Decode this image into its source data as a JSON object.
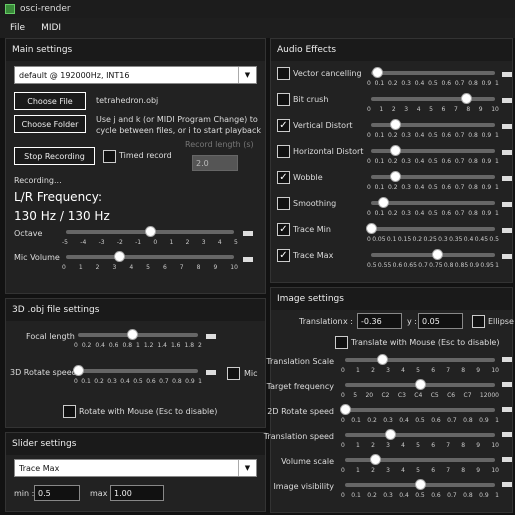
{
  "window": {
    "title": "osci-render"
  },
  "menu": [
    "File",
    "MIDI"
  ],
  "main": {
    "header": "Main settings",
    "device": "default @ 192000Hz, INT16",
    "choose_file": "Choose File",
    "file_name": "tetrahedron.obj",
    "choose_folder": "Choose Folder",
    "hint": "Use j and k (or MIDI Program Change) to cycle between files, or i to start playback",
    "stop_recording": "Stop Recording",
    "timed_record": "Timed record",
    "record_length_label": "Record length (s)",
    "record_length_value": "2.0",
    "recording": "Recording...",
    "freq_label": "L/R Frequency:",
    "freq_value": "130 Hz / 130 Hz",
    "octave_label": "Octave",
    "octave_ticks": [
      "-5",
      "-4",
      "-3",
      "-2",
      "-1",
      "0",
      "1",
      "2",
      "3",
      "4",
      "5"
    ],
    "octave_value": 0,
    "volume_label": "Mic Volume",
    "volume_ticks": [
      "0",
      "1",
      "2",
      "3",
      "4",
      "5",
      "6",
      "7",
      "8",
      "9",
      "10"
    ],
    "volume_value": 3.2
  },
  "obj": {
    "header": "3D .obj file settings",
    "focal_label": "Focal length",
    "focal_ticks": [
      "0",
      "0.2",
      "0.4",
      "0.6",
      "0.8",
      "1",
      "1.2",
      "1.4",
      "1.6",
      "1.8",
      "2"
    ],
    "focal_value": 0.9,
    "rotate_label": "3D Rotate speed",
    "rotate_ticks": [
      "0",
      "0.1",
      "0.2",
      "0.3",
      "0.4",
      "0.5",
      "0.6",
      "0.7",
      "0.8",
      "0.9",
      "1"
    ],
    "rotate_value": 0,
    "mic_label": "Mic",
    "rotate_mouse": "Rotate with Mouse (Esc to disable)"
  },
  "slider": {
    "header": "Slider settings",
    "selected": "Trace Max",
    "min_label": "min :",
    "min_value": "0.5",
    "max_label": "max :",
    "max_value": "1.00"
  },
  "effects": {
    "header": "Audio Effects",
    "items": [
      {
        "label": "Vector cancelling",
        "checked": false,
        "ticks": [
          "0",
          "0.1",
          "0.2",
          "0.3",
          "0.4",
          "0.5",
          "0.6",
          "0.7",
          "0.8",
          "0.9",
          "1"
        ],
        "value": 0.05
      },
      {
        "label": "Bit crush",
        "checked": false,
        "ticks": [
          "0",
          "1",
          "2",
          "3",
          "4",
          "5",
          "6",
          "7",
          "8",
          "9",
          "10"
        ],
        "value": 7.7
      },
      {
        "label": "Vertical Distort",
        "checked": true,
        "ticks": [
          "0",
          "0.1",
          "0.2",
          "0.3",
          "0.4",
          "0.5",
          "0.6",
          "0.7",
          "0.8",
          "0.9",
          "1"
        ],
        "value": 0.2
      },
      {
        "label": "Horizontal Distort",
        "checked": false,
        "ticks": [
          "0",
          "0.1",
          "0.2",
          "0.3",
          "0.4",
          "0.5",
          "0.6",
          "0.7",
          "0.8",
          "0.9",
          "1"
        ],
        "value": 0.2
      },
      {
        "label": "Wobble",
        "checked": true,
        "ticks": [
          "0",
          "0.1",
          "0.2",
          "0.3",
          "0.4",
          "0.5",
          "0.6",
          "0.7",
          "0.8",
          "0.9",
          "1"
        ],
        "value": 0.2
      },
      {
        "label": "Smoothing",
        "checked": false,
        "ticks": [
          "0",
          "0.1",
          "0.2",
          "0.3",
          "0.4",
          "0.5",
          "0.6",
          "0.7",
          "0.8",
          "0.9",
          "1"
        ],
        "value": 0.1
      },
      {
        "label": "Trace Min",
        "checked": true,
        "ticks": [
          "0",
          "0.05",
          "0.1",
          "0.15",
          "0.2",
          "0.25",
          "0.3",
          "0.35",
          "0.4",
          "0.45",
          "0.5"
        ],
        "value": 0.0
      },
      {
        "label": "Trace Max",
        "checked": true,
        "ticks": [
          "0.5",
          "0.55",
          "0.6",
          "0.65",
          "0.7",
          "0.75",
          "0.8",
          "0.85",
          "0.9",
          "0.95",
          "1"
        ],
        "value": 0.77
      }
    ]
  },
  "image": {
    "header": "Image settings",
    "translation_label": "Translation",
    "x_label": "x :",
    "x_value": "-0.36",
    "y_label": "y :",
    "y_value": "0.05",
    "ellipse_label": "Ellipse",
    "translate_mouse": "Translate with Mouse (Esc to disable)",
    "rows": [
      {
        "label": "Translation Scale",
        "ticks": [
          "0",
          "1",
          "2",
          "3",
          "4",
          "5",
          "6",
          "7",
          "8",
          "9",
          "10"
        ],
        "value": 0.25
      },
      {
        "label": "Target frequency",
        "ticks": [
          "0",
          "5",
          "20",
          "C2",
          "C3",
          "C4",
          "C5",
          "C6",
          "C7",
          "12000"
        ],
        "value": 0.5
      },
      {
        "label": "2D Rotate speed",
        "ticks": [
          "0",
          "0.1",
          "0.2",
          "0.3",
          "0.4",
          "0.5",
          "0.6",
          "0.7",
          "0.8",
          "0.9",
          "1"
        ],
        "value": 0
      },
      {
        "label": "Translation speed",
        "ticks": [
          "0",
          "1",
          "2",
          "3",
          "4",
          "5",
          "6",
          "7",
          "8",
          "9",
          "10"
        ],
        "value": 0.3
      },
      {
        "label": "Volume scale",
        "ticks": [
          "0",
          "1",
          "2",
          "3",
          "4",
          "5",
          "6",
          "7",
          "8",
          "9",
          "10"
        ],
        "value": 0.2
      },
      {
        "label": "Image visibility",
        "ticks": [
          "0",
          "0.1",
          "0.2",
          "0.3",
          "0.4",
          "0.5",
          "0.6",
          "0.7",
          "0.8",
          "0.9",
          "1"
        ],
        "value": 0.5
      }
    ]
  }
}
